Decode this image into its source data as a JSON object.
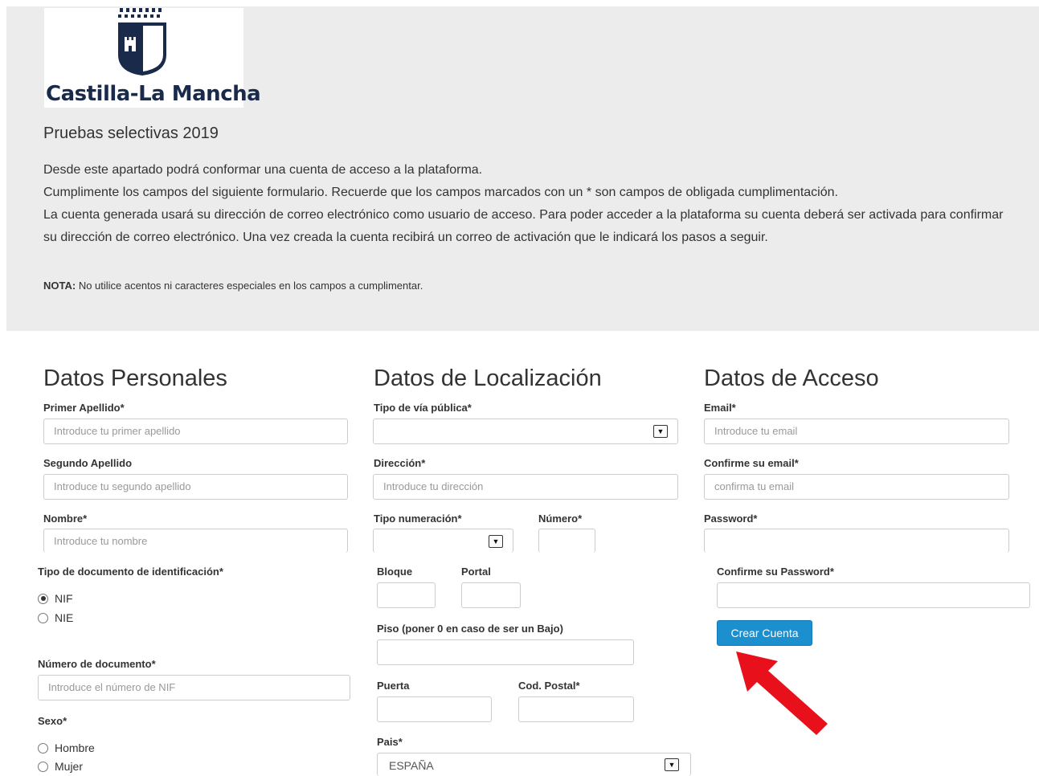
{
  "header": {
    "logo_text": "Castilla-La Mancha",
    "title": "Pruebas selectivas 2019",
    "intro_lines": [
      "Desde este apartado podrá conformar una cuenta de acceso a la plataforma.",
      "Cumplimente los campos del siguiente formulario. Recuerde que los campos marcados con un * son campos de obligada cumplimentación.",
      "La cuenta generada usará su dirección de correo electrónico como usuario de acceso. Para poder acceder a la plataforma su cuenta deberá ser activada para confirmar su dirección de correo electrónico. Una vez creada la cuenta recibirá un correo de activación que le indicará los pasos a seguir."
    ],
    "nota_label": "NOTA:",
    "nota_text": " No utilice acentos ni caracteres especiales en los campos a cumplimentar."
  },
  "personal": {
    "title": "Datos Personales",
    "primer_apellido_label": "Primer Apellido*",
    "primer_apellido_placeholder": "Introduce tu primer apellido",
    "segundo_apellido_label": "Segundo Apellido",
    "segundo_apellido_placeholder": "Introduce tu segundo apellido",
    "nombre_label": "Nombre*",
    "nombre_placeholder": "Introduce tu nombre",
    "tipo_doc_label": "Tipo de documento de identificación*",
    "tipo_doc_options": [
      "NIF",
      "NIE"
    ],
    "tipo_doc_selected": "NIF",
    "num_doc_label": "Número de documento*",
    "num_doc_placeholder": "Introduce el número de NIF",
    "sexo_label": "Sexo*",
    "sexo_options": [
      "Hombre",
      "Mujer"
    ]
  },
  "localizacion": {
    "title": "Datos de Localización",
    "tipo_via_label": "Tipo de vía pública*",
    "tipo_via_value": "",
    "direccion_label": "Dirección*",
    "direccion_placeholder": "Introduce tu dirección",
    "tipo_numeracion_label": "Tipo numeración*",
    "tipo_numeracion_value": "",
    "numero_label": "Número*",
    "bloque_label": "Bloque",
    "portal_label": "Portal",
    "piso_label": "Piso (poner 0 en caso de ser un Bajo)",
    "puerta_label": "Puerta",
    "cod_postal_label": "Cod. Postal*",
    "pais_label": "Pais*",
    "pais_value": "ESPAÑA"
  },
  "acceso": {
    "title": "Datos de Acceso",
    "email_label": "Email*",
    "email_placeholder": "Introduce tu email",
    "confirm_email_label": "Confirme su email*",
    "confirm_email_placeholder": "confirma tu email",
    "password_label": "Password*",
    "confirm_password_label": "Confirme su Password*",
    "submit_label": "Crear Cuenta"
  },
  "colors": {
    "header_bg": "#ececec",
    "button_bg": "#1c8fcf",
    "arrow": "#e8111b",
    "logo_blue": "#1a2a4a"
  }
}
